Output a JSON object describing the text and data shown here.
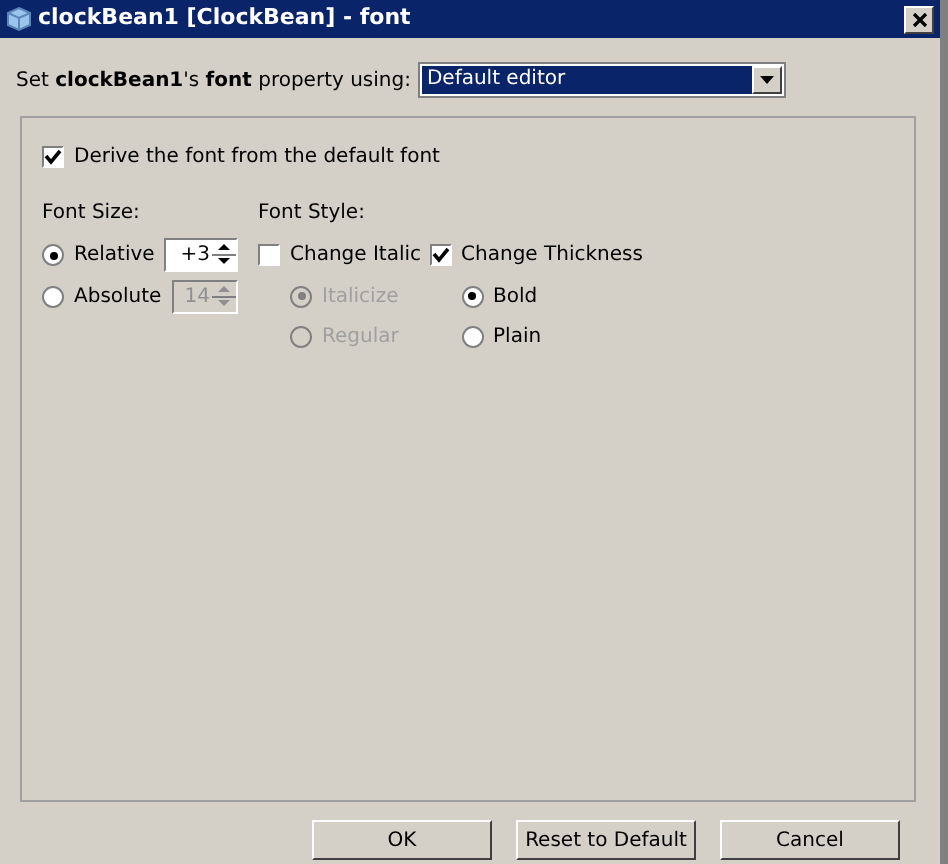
{
  "window": {
    "title": "clockBean1 [ClockBean] - font"
  },
  "editor_row": {
    "label": "Set **clockBean1**'s **font** property using:",
    "dropdown": "Default editor"
  },
  "derive": {
    "label": "Derive the font from the default font",
    "checked": true
  },
  "font_size": {
    "heading": "Font Size:",
    "options": [
      {
        "label": "Relative",
        "selected": true,
        "spinner": "+3",
        "disabled": false
      },
      {
        "label": "Absolute",
        "selected": false,
        "spinner": "14",
        "disabled": true
      }
    ]
  },
  "font_style": {
    "heading": "Font Style:",
    "groups": [
      {
        "label": "Change Italic",
        "checked": false,
        "options": [
          {
            "label": "Italicize",
            "selected": true,
            "disabled": true
          },
          {
            "label": "Regular",
            "selected": false,
            "disabled": true
          }
        ]
      },
      {
        "label": "Change Thickness",
        "checked": true,
        "options": [
          {
            "label": "Bold",
            "selected": true,
            "disabled": false
          },
          {
            "label": "Plain",
            "selected": false,
            "disabled": false
          }
        ]
      }
    ]
  },
  "buttons": [
    "OK",
    "Reset to Default",
    "Cancel"
  ]
}
